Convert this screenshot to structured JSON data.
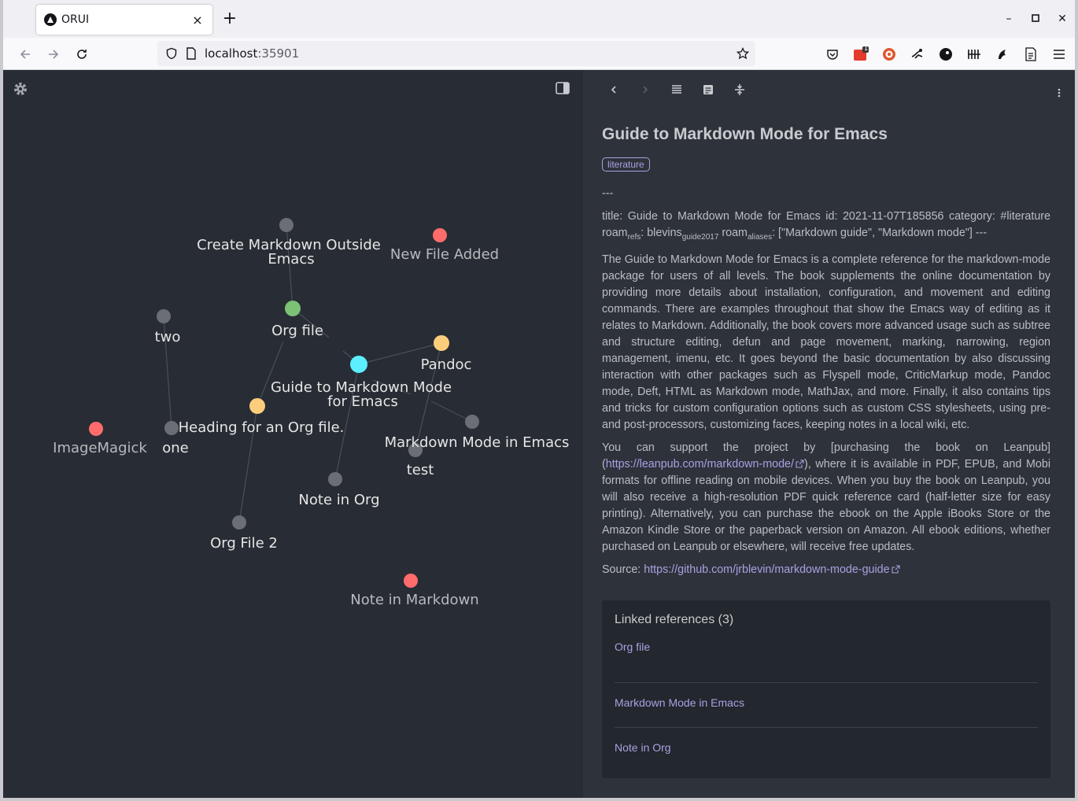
{
  "browser": {
    "tab_title": "ORUI",
    "tab_close": "×",
    "new_tab": "+",
    "url_host": "localhost",
    "url_port": ":35901",
    "window_controls": {
      "minimize": "–",
      "maximize": "◻",
      "close": "✕"
    },
    "extension_badge": "1"
  },
  "graph": {
    "nodes": [
      {
        "id": "create-md",
        "label": "Create Markdown Outside",
        "label2": "Emacs",
        "color": "#6b6e77",
        "dim": false
      },
      {
        "id": "new-file",
        "label": "New File Added",
        "label2": "",
        "color": "#ff6c6b",
        "dim": true
      },
      {
        "id": "org-file",
        "label": "Org file",
        "label2": "",
        "color": "#7bc275",
        "dim": false
      },
      {
        "id": "two",
        "label": "two",
        "label2": "",
        "color": "#6b6e77",
        "dim": false
      },
      {
        "id": "pandoc",
        "label": "Pandoc",
        "label2": "",
        "color": "#fcce7b",
        "dim": false
      },
      {
        "id": "guide",
        "label": "Guide to Markdown Mode",
        "label2": "for Emacs",
        "color": "#5cefff",
        "dim": false
      },
      {
        "id": "heading",
        "label": "Heading for an Org file.",
        "label2": "",
        "color": "#fcce7b",
        "dim": false
      },
      {
        "id": "imagemagick",
        "label": "ImageMagick",
        "label2": "",
        "color": "#ff6c6b",
        "dim": true
      },
      {
        "id": "one",
        "label": "one",
        "label2": "",
        "color": "#6b6e77",
        "dim": false
      },
      {
        "id": "md-mode",
        "label": "Markdown Mode in Emacs",
        "label2": "",
        "color": "#6b6e77",
        "dim": false
      },
      {
        "id": "test",
        "label": "test",
        "label2": "",
        "color": "#6b6e77",
        "dim": false
      },
      {
        "id": "note-org",
        "label": "Note in Org",
        "label2": "",
        "color": "#6b6e77",
        "dim": false
      },
      {
        "id": "org-file-2",
        "label": "Org File 2",
        "label2": "",
        "color": "#6b6e77",
        "dim": false
      },
      {
        "id": "note-md",
        "label": "Note in Markdown",
        "label2": "",
        "color": "#ff6c6b",
        "dim": true
      }
    ]
  },
  "note": {
    "title": "Guide to Markdown Mode for Emacs",
    "tag": "literature",
    "separator": "---",
    "meta_a": "title: Guide to Markdown Mode for Emacs id: 2021-11-07T185856 category: #literature roam",
    "meta_refs_sub": "refs",
    "meta_b": ": blevins",
    "meta_guide_sub": "guide2017",
    "meta_c": " roam",
    "meta_aliases_sub": "aliases",
    "meta_d": ": [\"Markdown guide\", \"Markdown mode\"] ---",
    "para1": "The Guide to Markdown Mode for Emacs is a complete reference for the markdown-mode package for users of all levels. The book supplements the online documentation by providing more details about installation, configuration, and movement and editing commands. There are examples throughout that show the Emacs way of editing as it relates to Markdown. Additionally, the book covers more advanced usage such as subtree and structure editing, defun and page movement, marking, narrowing, region management, imenu, etc. It goes beyond the basic documentation by also discussing interaction with other packages such as Flyspell mode, CriticMarkup mode, Pandoc mode, Deft, HTML as Markdown mode, MathJax, and more. Finally, it also contains tips and tricks for custom configuration options such as custom CSS stylesheets, using pre- and post-processors, customizing faces, keeping notes in a local wiki, etc.",
    "para2_a": "You can support the project by [purchasing the book on Leanpub](",
    "para2_link": "https://leanpub.com/markdown-mode/",
    "para2_b": "), where it is available in PDF, EPUB, and Mobi formats for offline reading on mobile devices. When you buy the book on Leanpub, you will also receive a high-resolution PDF quick reference card (half-letter size for easy printing). Alternatively, you can purchase the ebook on the Apple iBooks Store or the Amazon Kindle Store or the paperback version on Amazon. All ebook editions, whether purchased on Leanpub or elsewhere, will receive free updates.",
    "source_label": "Source: ",
    "source_link": "https://github.com/jrblevin/markdown-mode-guide"
  },
  "backlinks": {
    "title": "Linked references (3)",
    "items": [
      "Org file",
      "Markdown Mode in Emacs",
      "Note in Org"
    ]
  }
}
